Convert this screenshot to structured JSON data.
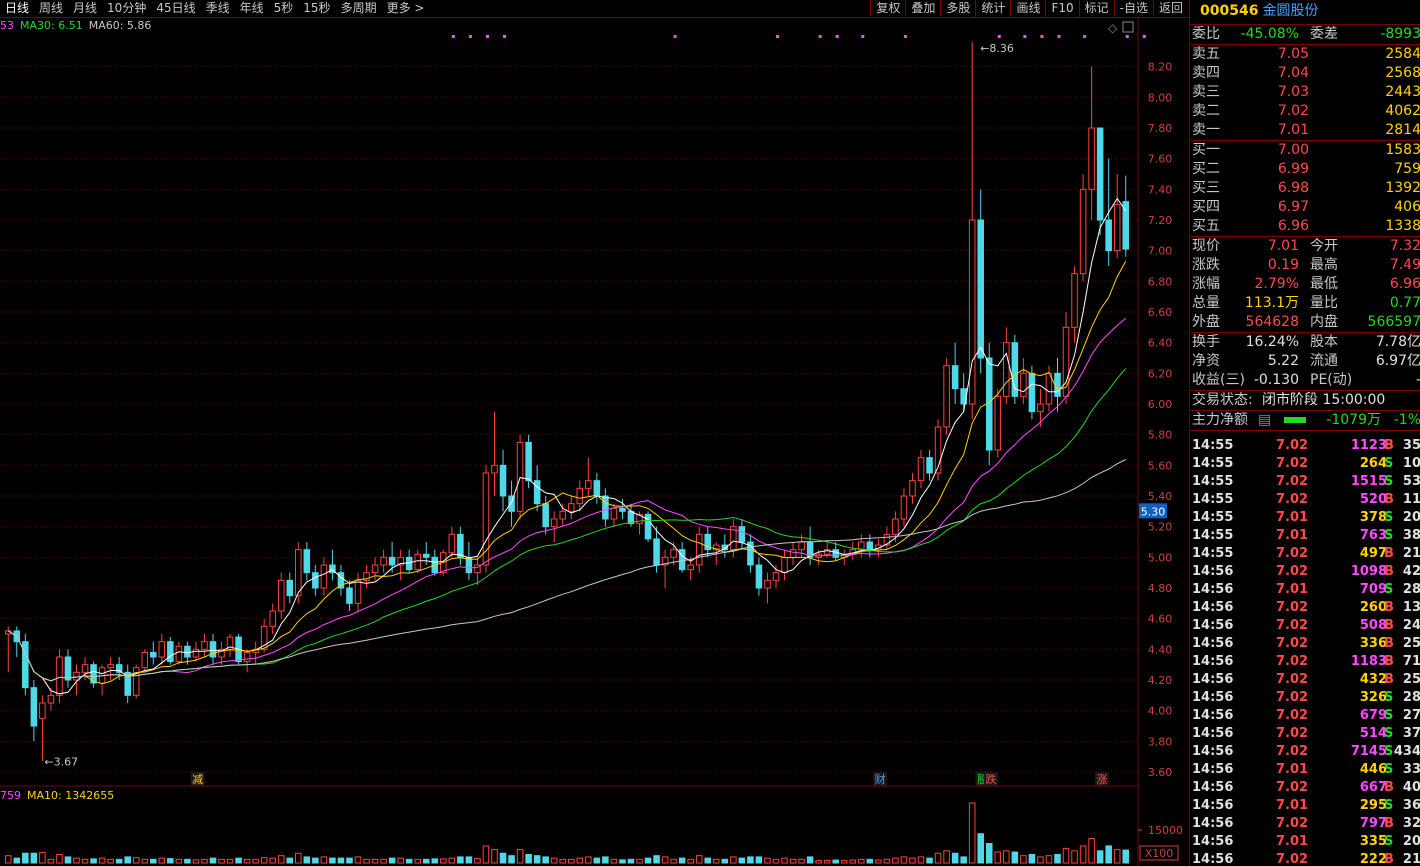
{
  "toolbar": {
    "periods": [
      "日线",
      "周线",
      "月线",
      "10分钟",
      "45日线",
      "季线",
      "年线",
      "5秒",
      "15秒",
      "多周期",
      "更多 >"
    ],
    "tools": [
      "复权",
      "叠加",
      "多股",
      "统计",
      "画线",
      "F10",
      "标记",
      "-自选",
      "返回"
    ]
  },
  "ma_legend": [
    {
      "label": "53",
      "color": "#ff4aff"
    },
    {
      "label": "MA30: 6.51",
      "color": "#22d822"
    },
    {
      "label": "MA60: 5.86",
      "color": "#c8c8c8"
    }
  ],
  "vol_legend": [
    {
      "label": "759",
      "color": "#ff4aff"
    },
    {
      "label": "MA10: 1342655",
      "color": "#ffd200"
    }
  ],
  "price_axis": {
    "labels": [
      "8.20",
      "8.00",
      "7.80",
      "7.60",
      "7.40",
      "7.20",
      "7.00",
      "6.80",
      "6.60",
      "6.40",
      "6.20",
      "6.00",
      "5.80",
      "5.60",
      "5.40",
      "5.20",
      "5.00",
      "4.80",
      "4.60",
      "4.40",
      "4.20",
      "4.00",
      "3.80",
      "3.60"
    ],
    "current_marker": "5.30"
  },
  "volume_axis": {
    "label": "15000",
    "unit": "X100"
  },
  "annotations": {
    "high": "8.36",
    "low": "3.67",
    "events": [
      {
        "text": "减"
      },
      {
        "text": "财"
      },
      {
        "text": "股"
      },
      {
        "text": "跌"
      },
      {
        "text": "涨"
      }
    ]
  },
  "panel": {
    "code": "000546",
    "name": "金圆股份",
    "weibi": {
      "label": "委比",
      "value": "-45.08%",
      "label2": "委差",
      "value2": "-8993"
    },
    "asks": [
      {
        "label": "卖五",
        "price": "7.05",
        "vol": "2584"
      },
      {
        "label": "卖四",
        "price": "7.04",
        "vol": "2568"
      },
      {
        "label": "卖三",
        "price": "7.03",
        "vol": "2443"
      },
      {
        "label": "卖二",
        "price": "7.02",
        "vol": "4062"
      },
      {
        "label": "卖一",
        "price": "7.01",
        "vol": "2814"
      }
    ],
    "bids": [
      {
        "label": "买一",
        "price": "7.00",
        "vol": "1583"
      },
      {
        "label": "买二",
        "price": "6.99",
        "vol": "759"
      },
      {
        "label": "买三",
        "price": "6.98",
        "vol": "1392"
      },
      {
        "label": "买四",
        "price": "6.97",
        "vol": "406"
      },
      {
        "label": "买五",
        "price": "6.96",
        "vol": "1338"
      }
    ],
    "quote": [
      {
        "l1": "现价",
        "v1": "7.01",
        "c1": "red",
        "l2": "今开",
        "v2": "7.32",
        "c2": "red"
      },
      {
        "l1": "涨跌",
        "v1": "0.19",
        "c1": "red",
        "l2": "最高",
        "v2": "7.49",
        "c2": "red"
      },
      {
        "l1": "涨幅",
        "v1": "2.79%",
        "c1": "red",
        "l2": "最低",
        "v2": "6.96",
        "c2": "red"
      },
      {
        "l1": "总量",
        "v1": "113.1万",
        "c1": "yel",
        "l2": "量比",
        "v2": "0.77",
        "c2": "grn"
      },
      {
        "l1": "外盘",
        "v1": "564628",
        "c1": "red",
        "l2": "内盘",
        "v2": "566597",
        "c2": "grn"
      }
    ],
    "stats": [
      {
        "l1": "换手",
        "v1": "16.24%",
        "l2": "股本",
        "v2": "7.78亿"
      },
      {
        "l1": "净资",
        "v1": "5.22",
        "l2": "流通",
        "v2": "6.97亿"
      },
      {
        "l1": "收益(三)",
        "v1": "-0.130",
        "l2": "PE(动)",
        "v2": "-"
      }
    ],
    "status": {
      "label": "交易状态:",
      "value": "闭市阶段 15:00:00"
    },
    "mainflow": {
      "label": "主力净额",
      "value": "-1079万",
      "pct": "-1%"
    },
    "ticks": [
      {
        "t": "14:55",
        "p": "7.02",
        "v": "1123",
        "vc": "#ff4aff",
        "bs": "B",
        "n": "35"
      },
      {
        "t": "14:55",
        "p": "7.02",
        "v": "264",
        "vc": "#ffd200",
        "bs": "S",
        "n": "10"
      },
      {
        "t": "14:55",
        "p": "7.02",
        "v": "1515",
        "vc": "#ff4aff",
        "bs": "S",
        "n": "53"
      },
      {
        "t": "14:55",
        "p": "7.02",
        "v": "520",
        "vc": "#ff4aff",
        "bs": "B",
        "n": "11"
      },
      {
        "t": "14:55",
        "p": "7.01",
        "v": "378",
        "vc": "#ffd200",
        "bs": "S",
        "n": "20"
      },
      {
        "t": "14:55",
        "p": "7.01",
        "v": "763",
        "vc": "#ff4aff",
        "bs": "S",
        "n": "38"
      },
      {
        "t": "14:55",
        "p": "7.02",
        "v": "497",
        "vc": "#ffd200",
        "bs": "B",
        "n": "21"
      },
      {
        "t": "14:56",
        "p": "7.02",
        "v": "1098",
        "vc": "#ff4aff",
        "bs": "B",
        "n": "42"
      },
      {
        "t": "14:56",
        "p": "7.01",
        "v": "709",
        "vc": "#ff4aff",
        "bs": "S",
        "n": "28"
      },
      {
        "t": "14:56",
        "p": "7.02",
        "v": "260",
        "vc": "#ffd200",
        "bs": "B",
        "n": "13"
      },
      {
        "t": "14:56",
        "p": "7.02",
        "v": "508",
        "vc": "#ff4aff",
        "bs": "B",
        "n": "24"
      },
      {
        "t": "14:56",
        "p": "7.02",
        "v": "336",
        "vc": "#ffd200",
        "bs": "B",
        "n": "25"
      },
      {
        "t": "14:56",
        "p": "7.02",
        "v": "1183",
        "vc": "#ff4aff",
        "bs": "B",
        "n": "71"
      },
      {
        "t": "14:56",
        "p": "7.02",
        "v": "432",
        "vc": "#ffd200",
        "bs": "B",
        "n": "25"
      },
      {
        "t": "14:56",
        "p": "7.02",
        "v": "326",
        "vc": "#ffd200",
        "bs": "S",
        "n": "28"
      },
      {
        "t": "14:56",
        "p": "7.02",
        "v": "679",
        "vc": "#ff4aff",
        "bs": "S",
        "n": "27"
      },
      {
        "t": "14:56",
        "p": "7.02",
        "v": "514",
        "vc": "#ff4aff",
        "bs": "S",
        "n": "37"
      },
      {
        "t": "14:56",
        "p": "7.02",
        "v": "7145",
        "vc": "#ff4aff",
        "bs": "S",
        "n": "434"
      },
      {
        "t": "14:56",
        "p": "7.01",
        "v": "446",
        "vc": "#ffd200",
        "bs": "S",
        "n": "33"
      },
      {
        "t": "14:56",
        "p": "7.02",
        "v": "667",
        "vc": "#ff4aff",
        "bs": "B",
        "n": "40"
      },
      {
        "t": "14:56",
        "p": "7.01",
        "v": "295",
        "vc": "#ffd200",
        "bs": "S",
        "n": "36"
      },
      {
        "t": "14:56",
        "p": "7.02",
        "v": "797",
        "vc": "#ff4aff",
        "bs": "B",
        "n": "32"
      },
      {
        "t": "14:56",
        "p": "7.01",
        "v": "335",
        "vc": "#ffd200",
        "bs": "S",
        "n": "20"
      },
      {
        "t": "14:56",
        "p": "7.02",
        "v": "222",
        "vc": "#ffd200",
        "bs": "B",
        "n": "21"
      }
    ]
  },
  "chart_data": {
    "type": "candlestick",
    "title": "",
    "ylim": [
      3.6,
      8.4
    ],
    "candles": [
      [
        4.5,
        4.55,
        4.25,
        4.52
      ],
      [
        4.52,
        4.55,
        4.35,
        4.45
      ],
      [
        4.45,
        4.5,
        4.1,
        4.15
      ],
      [
        4.15,
        4.2,
        3.8,
        3.9
      ],
      [
        3.95,
        4.1,
        3.67,
        4.05
      ],
      [
        4.05,
        4.15,
        4.0,
        4.1
      ],
      [
        4.1,
        4.4,
        4.05,
        4.35
      ],
      [
        4.35,
        4.4,
        4.15,
        4.2
      ],
      [
        4.2,
        4.3,
        4.1,
        4.25
      ],
      [
        4.25,
        4.35,
        4.2,
        4.3
      ],
      [
        4.3,
        4.32,
        4.15,
        4.18
      ],
      [
        4.18,
        4.3,
        4.1,
        4.28
      ],
      [
        4.28,
        4.35,
        4.2,
        4.3
      ],
      [
        4.3,
        4.35,
        4.2,
        4.25
      ],
      [
        4.25,
        4.3,
        4.05,
        4.1
      ],
      [
        4.1,
        4.3,
        4.08,
        4.28
      ],
      [
        4.28,
        4.4,
        4.25,
        4.38
      ],
      [
        4.38,
        4.45,
        4.3,
        4.35
      ],
      [
        4.35,
        4.5,
        4.3,
        4.45
      ],
      [
        4.45,
        4.48,
        4.3,
        4.32
      ],
      [
        4.32,
        4.45,
        4.3,
        4.42
      ],
      [
        4.42,
        4.45,
        4.3,
        4.35
      ],
      [
        4.35,
        4.45,
        4.32,
        4.4
      ],
      [
        4.4,
        4.5,
        4.35,
        4.45
      ],
      [
        4.45,
        4.5,
        4.3,
        4.35
      ],
      [
        4.35,
        4.45,
        4.3,
        4.4
      ],
      [
        4.4,
        4.5,
        4.35,
        4.48
      ],
      [
        4.48,
        4.5,
        4.3,
        4.32
      ],
      [
        4.32,
        4.4,
        4.25,
        4.38
      ],
      [
        4.38,
        4.45,
        4.3,
        4.4
      ],
      [
        4.4,
        4.6,
        4.38,
        4.55
      ],
      [
        4.55,
        4.7,
        4.5,
        4.65
      ],
      [
        4.65,
        4.9,
        4.6,
        4.85
      ],
      [
        4.85,
        4.9,
        4.7,
        4.75
      ],
      [
        4.75,
        5.1,
        4.7,
        5.05
      ],
      [
        5.05,
        5.1,
        4.85,
        4.9
      ],
      [
        4.9,
        4.95,
        4.75,
        4.8
      ],
      [
        4.8,
        5.0,
        4.75,
        4.95
      ],
      [
        4.95,
        5.05,
        4.85,
        4.9
      ],
      [
        4.9,
        4.95,
        4.75,
        4.8
      ],
      [
        4.8,
        4.85,
        4.65,
        4.7
      ],
      [
        4.7,
        4.9,
        4.65,
        4.85
      ],
      [
        4.85,
        4.95,
        4.8,
        4.9
      ],
      [
        4.9,
        5.0,
        4.85,
        4.95
      ],
      [
        4.95,
        5.05,
        4.9,
        5.0
      ],
      [
        5.0,
        5.1,
        4.9,
        4.95
      ],
      [
        4.95,
        5.05,
        4.85,
        5.0
      ],
      [
        5.0,
        5.05,
        4.9,
        4.92
      ],
      [
        4.92,
        5.05,
        4.9,
        5.02
      ],
      [
        5.02,
        5.1,
        4.95,
        5.0
      ],
      [
        5.0,
        5.05,
        4.88,
        4.9
      ],
      [
        4.9,
        5.05,
        4.88,
        5.03
      ],
      [
        5.03,
        5.2,
        5.0,
        5.15
      ],
      [
        5.15,
        5.2,
        4.95,
        5.0
      ],
      [
        5.0,
        5.1,
        4.85,
        4.9
      ],
      [
        4.9,
        5.0,
        4.82,
        4.95
      ],
      [
        4.95,
        5.6,
        4.9,
        5.55
      ],
      [
        5.55,
        5.95,
        5.4,
        5.6
      ],
      [
        5.6,
        5.7,
        5.3,
        5.4
      ],
      [
        5.4,
        5.5,
        5.2,
        5.3
      ],
      [
        5.3,
        5.8,
        5.25,
        5.75
      ],
      [
        5.75,
        5.8,
        5.45,
        5.5
      ],
      [
        5.5,
        5.6,
        5.3,
        5.35
      ],
      [
        5.35,
        5.4,
        5.15,
        5.2
      ],
      [
        5.2,
        5.3,
        5.1,
        5.25
      ],
      [
        5.25,
        5.35,
        5.2,
        5.3
      ],
      [
        5.3,
        5.4,
        5.25,
        5.35
      ],
      [
        5.35,
        5.5,
        5.3,
        5.45
      ],
      [
        5.45,
        5.65,
        5.4,
        5.5
      ],
      [
        5.5,
        5.55,
        5.35,
        5.4
      ],
      [
        5.4,
        5.45,
        5.2,
        5.25
      ],
      [
        5.25,
        5.35,
        5.2,
        5.32
      ],
      [
        5.32,
        5.38,
        5.25,
        5.3
      ],
      [
        5.3,
        5.35,
        5.2,
        5.22
      ],
      [
        5.22,
        5.3,
        5.15,
        5.28
      ],
      [
        5.28,
        5.3,
        5.1,
        5.12
      ],
      [
        5.12,
        5.2,
        4.9,
        4.95
      ],
      [
        4.95,
        5.05,
        4.8,
        5.0
      ],
      [
        5.0,
        5.1,
        4.95,
        5.05
      ],
      [
        5.05,
        5.1,
        4.9,
        4.92
      ],
      [
        4.92,
        5.0,
        4.85,
        4.95
      ],
      [
        4.95,
        5.2,
        4.9,
        5.15
      ],
      [
        5.15,
        5.2,
        5.0,
        5.05
      ],
      [
        5.05,
        5.1,
        4.95,
        5.08
      ],
      [
        5.08,
        5.15,
        5.0,
        5.05
      ],
      [
        5.05,
        5.25,
        5.0,
        5.2
      ],
      [
        5.2,
        5.25,
        5.05,
        5.1
      ],
      [
        5.1,
        5.15,
        4.9,
        4.95
      ],
      [
        4.95,
        5.0,
        4.75,
        4.8
      ],
      [
        4.8,
        4.9,
        4.7,
        4.85
      ],
      [
        4.85,
        4.95,
        4.8,
        4.9
      ],
      [
        4.9,
        5.05,
        4.85,
        5.0
      ],
      [
        5.0,
        5.1,
        4.95,
        5.05
      ],
      [
        5.05,
        5.15,
        5.0,
        5.1
      ],
      [
        5.1,
        5.2,
        4.95,
        5.0
      ],
      [
        5.0,
        5.05,
        4.95,
        5.02
      ],
      [
        5.02,
        5.1,
        5.0,
        5.05
      ],
      [
        5.05,
        5.1,
        4.98,
        5.0
      ],
      [
        5.0,
        5.05,
        4.95,
        5.02
      ],
      [
        5.02,
        5.1,
        4.98,
        5.05
      ],
      [
        5.05,
        5.15,
        5.0,
        5.1
      ],
      [
        5.1,
        5.15,
        5.0,
        5.05
      ],
      [
        5.05,
        5.12,
        5.0,
        5.08
      ],
      [
        5.08,
        5.2,
        5.05,
        5.15
      ],
      [
        5.15,
        5.3,
        5.1,
        5.25
      ],
      [
        5.25,
        5.45,
        5.2,
        5.4
      ],
      [
        5.4,
        5.55,
        5.35,
        5.5
      ],
      [
        5.5,
        5.7,
        5.45,
        5.65
      ],
      [
        5.65,
        5.7,
        5.5,
        5.55
      ],
      [
        5.55,
        5.9,
        5.5,
        5.85
      ],
      [
        5.85,
        6.3,
        5.8,
        6.25
      ],
      [
        6.25,
        6.4,
        6.0,
        6.1
      ],
      [
        6.1,
        6.2,
        5.95,
        6.0
      ],
      [
        6.0,
        8.36,
        5.9,
        7.2
      ],
      [
        7.2,
        7.4,
        6.2,
        6.3
      ],
      [
        6.3,
        6.4,
        5.6,
        5.7
      ],
      [
        5.7,
        6.1,
        5.65,
        6.05
      ],
      [
        6.05,
        6.5,
        6.0,
        6.4
      ],
      [
        6.4,
        6.45,
        6.0,
        6.05
      ],
      [
        6.05,
        6.3,
        6.0,
        6.2
      ],
      [
        6.2,
        6.25,
        5.9,
        5.95
      ],
      [
        5.95,
        6.1,
        5.85,
        6.0
      ],
      [
        6.0,
        6.25,
        5.95,
        6.2
      ],
      [
        6.2,
        6.3,
        5.95,
        6.05
      ],
      [
        6.05,
        6.6,
        6.0,
        6.5
      ],
      [
        6.5,
        6.9,
        6.4,
        6.85
      ],
      [
        6.85,
        7.5,
        6.8,
        7.4
      ],
      [
        7.4,
        8.2,
        7.2,
        7.8
      ],
      [
        7.8,
        7.6,
        7.1,
        7.2
      ],
      [
        7.2,
        7.6,
        6.9,
        7.0
      ],
      [
        7.0,
        7.5,
        6.95,
        7.3
      ],
      [
        7.32,
        7.49,
        6.96,
        7.01
      ]
    ],
    "ma_series": [
      {
        "name": "MA30",
        "last": 6.51,
        "color": "#22d822"
      },
      {
        "name": "MA60",
        "last": 5.86,
        "color": "#c8c8c8"
      }
    ],
    "volume_ma10": 1342655
  }
}
